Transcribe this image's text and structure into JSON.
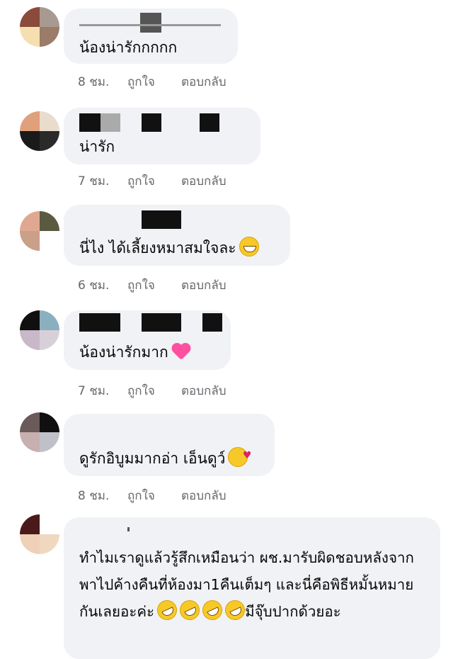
{
  "comments": [
    {
      "text": "น้องน่ารักกกกก",
      "time": "8 ชม.",
      "like": "ถูกใจ",
      "reply": "ตอบกลับ",
      "emoji": ""
    },
    {
      "text": "น่ารัก",
      "time": "7 ชม.",
      "like": "ถูกใจ",
      "reply": "ตอบกลับ",
      "emoji": ""
    },
    {
      "text": "นี่ไง ได้เลี้ยงหมาสมใจละ",
      "time": "6 ชม.",
      "like": "ถูกใจ",
      "reply": "ตอบกลับ",
      "emoji": "grinning-face"
    },
    {
      "text": "น้องน่ารักมาก",
      "time": "7 ชม.",
      "like": "ถูกใจ",
      "reply": "ตอบกลับ",
      "emoji": "growing-heart"
    },
    {
      "text": "ดูรักอิบูมมากอ่า เอ็นดูว์",
      "time": "8 ชม.",
      "like": "ถูกใจ",
      "reply": "ตอบกลับ",
      "emoji": "smiling-face-with-hearts"
    },
    {
      "text_part1": "ทำไมเราดูแล้วรู้สึกเหมือนว่า ผช.มารับผิดชอบหลังจากพาไปค้างคืนที่ห้องมา1คืนเต็มๆ และนี่คือพิธีหมั้นหมายกันเลยอะค่ะ",
      "text_part2": "มีจุ๊บปากด้วยอะ",
      "emoji": "rolling-on-the-floor-laughing"
    }
  ],
  "colors": {
    "bubble": "#f0f2f5",
    "meta": "#65676b",
    "text": "#050505"
  }
}
